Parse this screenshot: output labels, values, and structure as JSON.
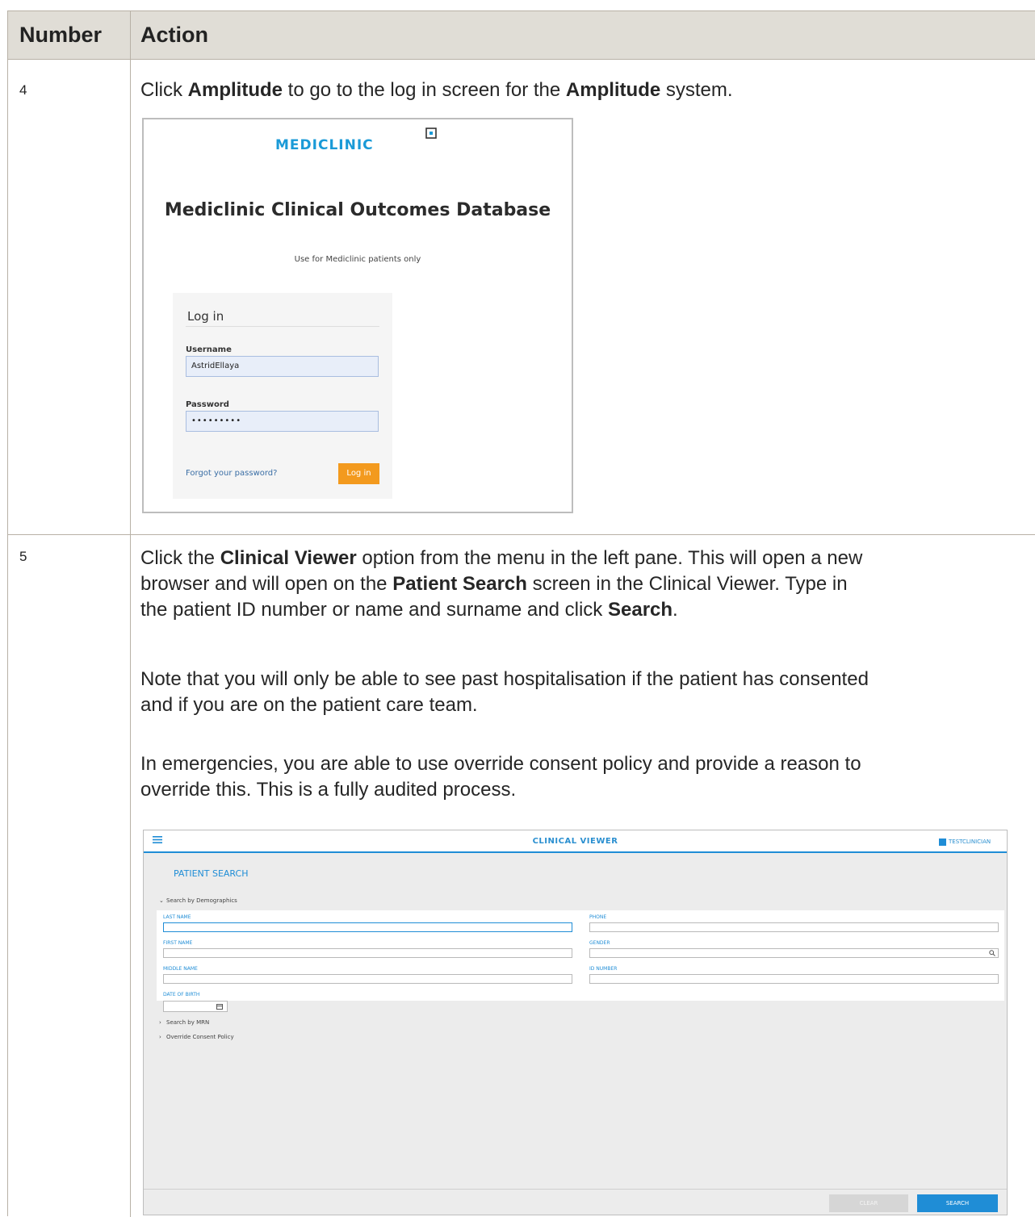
{
  "table": {
    "headers": {
      "number": "Number",
      "action": "Action"
    },
    "rows": [
      {
        "number": "4",
        "text": {
          "p1": "Click ",
          "b1": "Amplitude",
          "p2": " to go to the log in screen for the ",
          "b2": "Amplitude",
          "p3": " system."
        }
      },
      {
        "number": "5",
        "text": {
          "l1a": "Click the ",
          "l1b": "Clinical Viewer",
          "l1c": " option from the menu in the left pane. This will open a new",
          "l2a": "browser and will open on the ",
          "l2b": "Patient Search",
          "l2c": " screen in the Clinical Viewer. Type in",
          "l3a": "the patient ID number or name and surname and click ",
          "l3b": "Search",
          "l3c": ".",
          "n1": "Note that you will only be able to see past hospitalisation if the patient has consented",
          "n2": "and if you are on the patient care team.",
          "e1": "In emergencies, you are able to use override consent policy and provide a reason to",
          "e2": "override this. This is a fully audited process."
        }
      }
    ]
  },
  "login_screen": {
    "logo": "MEDICLINIC",
    "title": "Mediclinic Clinical Outcomes Database",
    "subtitle": "Use for Mediclinic patients only",
    "box_title": "Log in",
    "username_label": "Username",
    "username_value": "AstridEllaya",
    "password_label": "Password",
    "password_value": "•••••••••",
    "forgot_link": "Forgot your password?",
    "login_button": "Log in",
    "colors": {
      "brand": "#1a9ad7",
      "button": "#f39a1e"
    }
  },
  "clinical_viewer": {
    "title": "CLINICAL VIEWER",
    "user": "TESTCLINICIAN",
    "page_title": "PATIENT SEARCH",
    "section_demographics": "Search by Demographics",
    "section_mrn": "Search by MRN",
    "section_override": "Override Consent Policy",
    "fields": {
      "last_name": "LAST NAME",
      "first_name": "FIRST NAME",
      "middle_name": "MIDDLE NAME",
      "date_of_birth": "DATE OF BIRTH",
      "phone": "PHONE",
      "gender": "GENDER",
      "id_number": "ID NUMBER"
    },
    "clear_button": "CLEAR",
    "search_button": "SEARCH",
    "icons": [
      "menu-icon",
      "user-icon",
      "calendar-icon",
      "search-icon",
      "chevron-down-icon",
      "chevron-right-icon"
    ],
    "colors": {
      "accent": "#1f8dd6"
    }
  }
}
